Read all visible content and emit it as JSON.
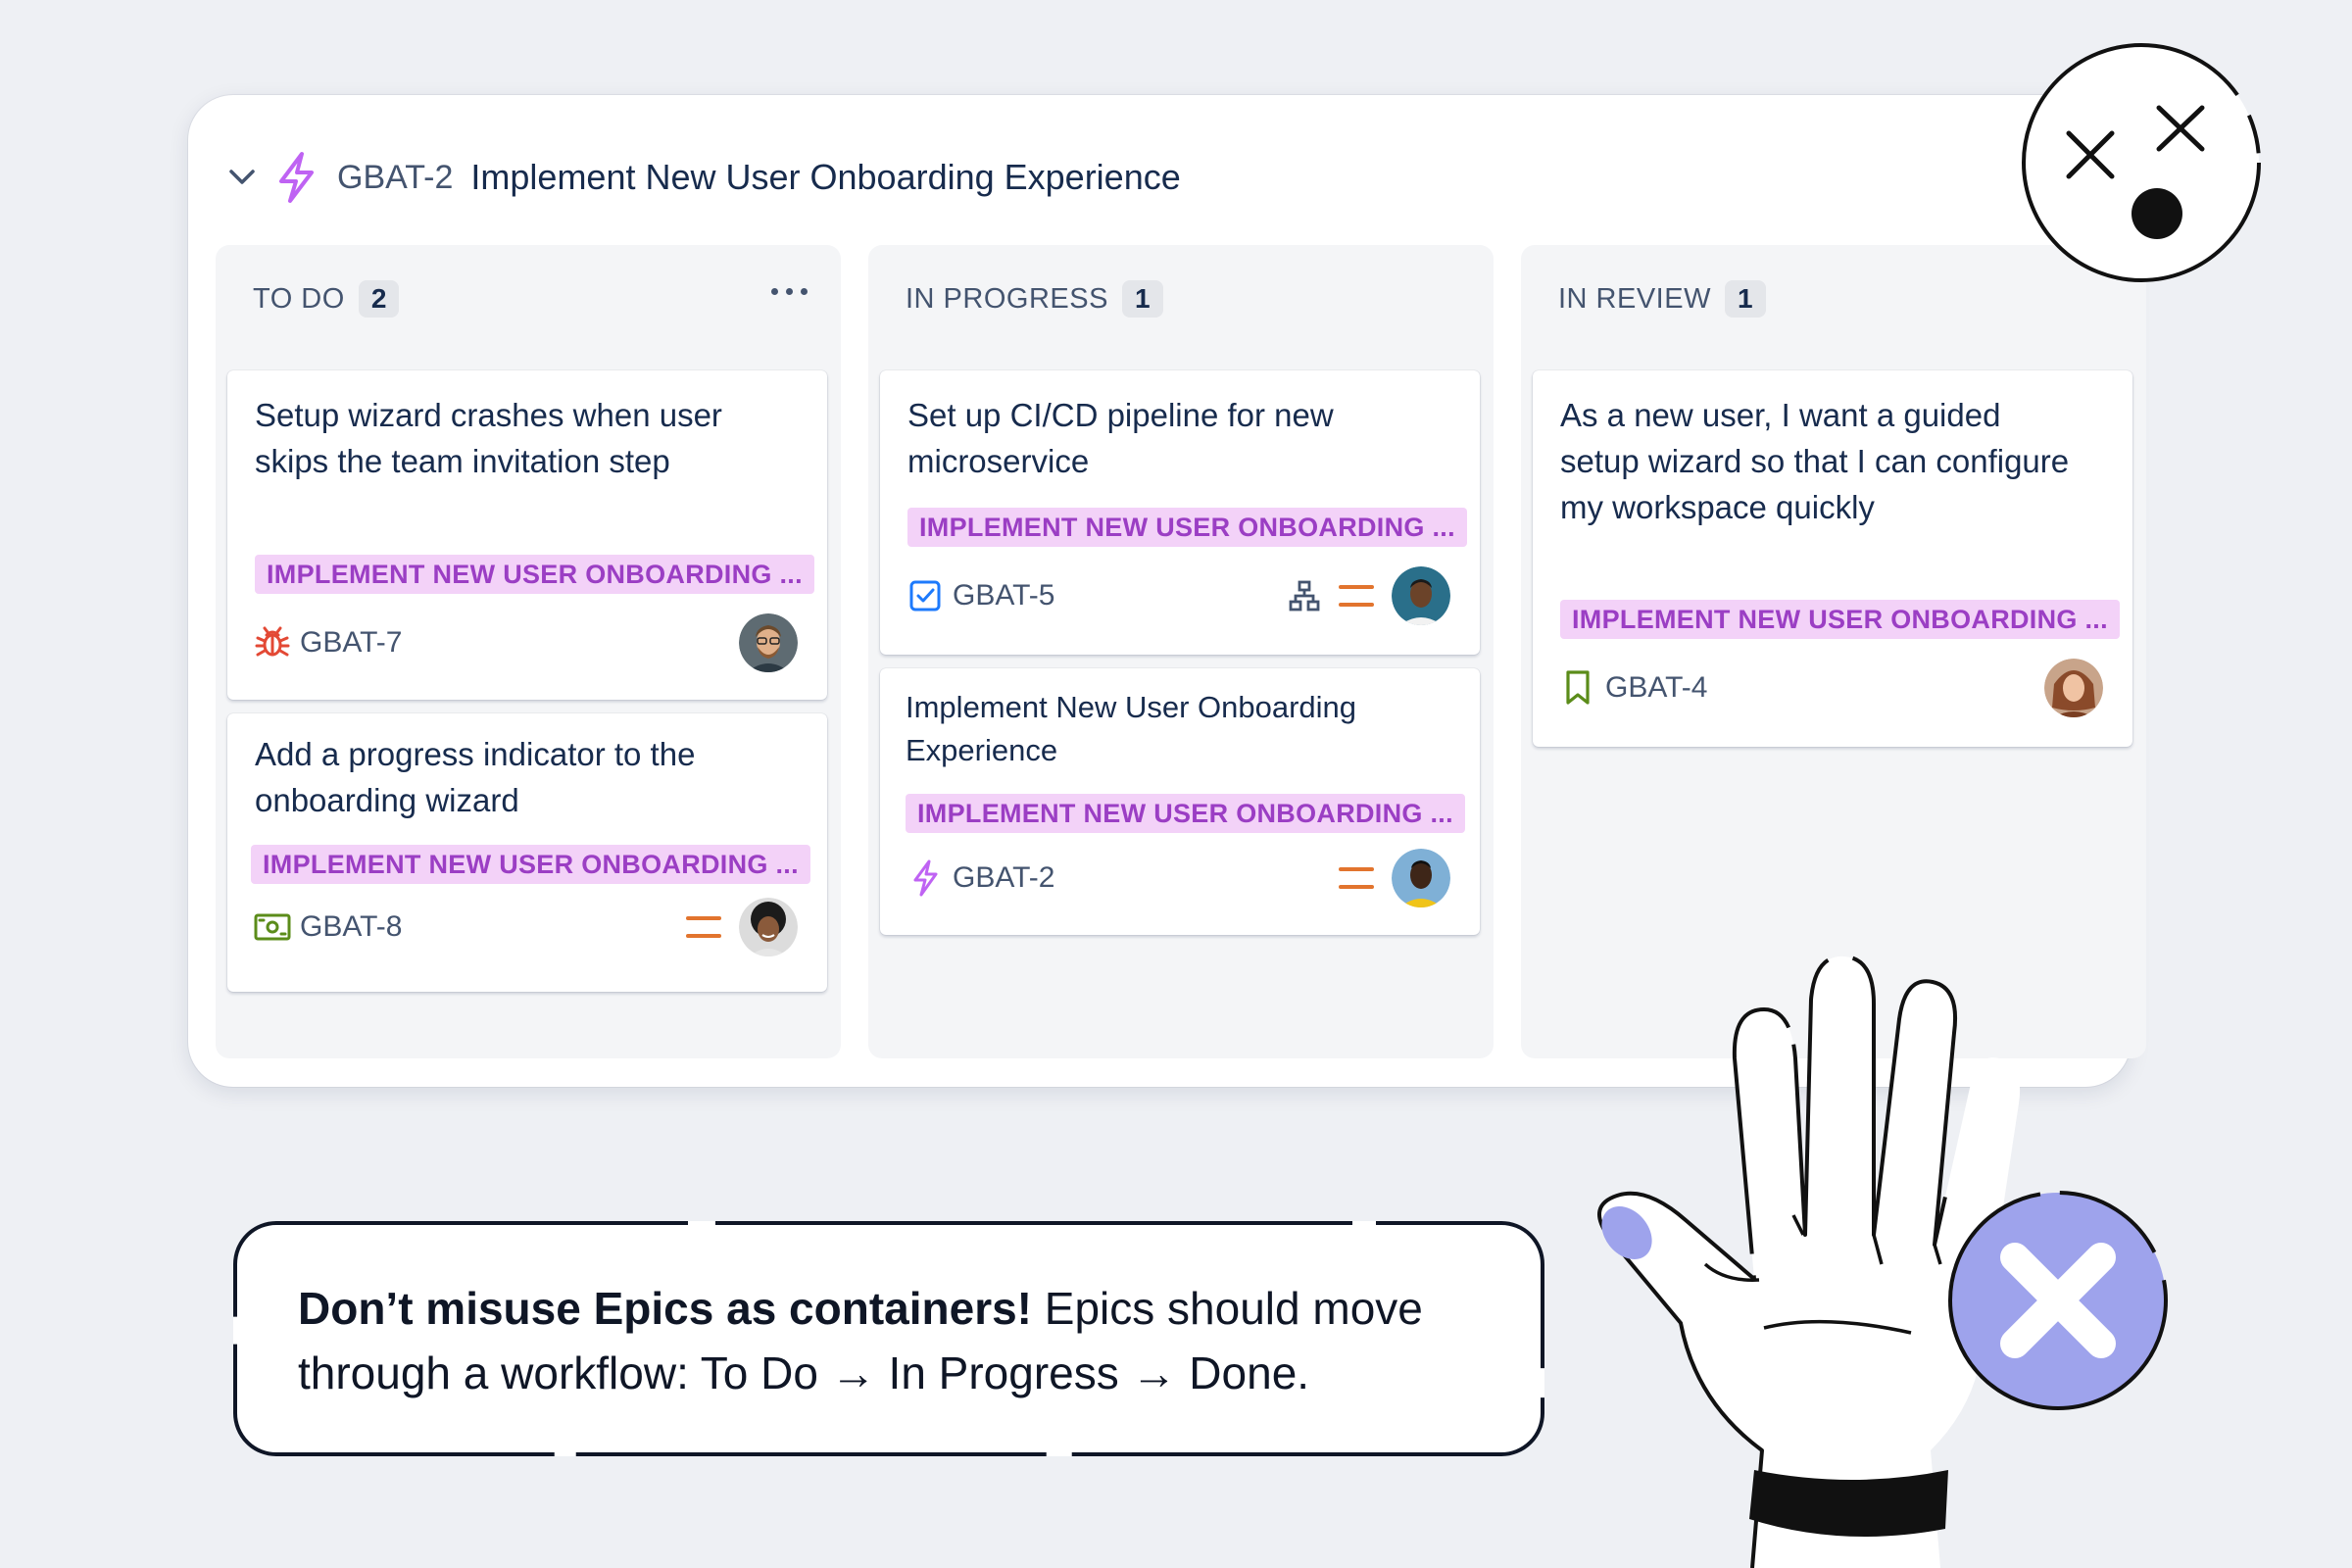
{
  "epic": {
    "key": "GBAT-2",
    "title": "Implement New User Onboarding Experience"
  },
  "columns": [
    {
      "name": "TO DO",
      "count": "2",
      "cards": [
        {
          "title": "Setup wizard crashes when user skips the team invitation step",
          "epic_label": "IMPLEMENT NEW USER ONBOARDING ...",
          "type_icon": "bug-icon",
          "key": "GBAT-7"
        },
        {
          "title": "Add a progress indicator to the onboarding wizard",
          "epic_label": "IMPLEMENT NEW USER ONBOARDING ...",
          "type_icon": "task-money-icon",
          "key": "GBAT-8"
        }
      ]
    },
    {
      "name": "IN PROGRESS",
      "count": "1",
      "cards": [
        {
          "title": "Set up CI/CD pipeline for new microservice",
          "epic_label": "IMPLEMENT NEW USER ONBOARDING ...",
          "type_icon": "task-checkbox-icon",
          "key": "GBAT-5"
        },
        {
          "title": "Implement New User Onboarding Experience",
          "epic_label": "IMPLEMENT NEW USER ONBOARDING ...",
          "type_icon": "epic-lightning-icon",
          "key": "GBAT-2"
        }
      ]
    },
    {
      "name": "IN REVIEW",
      "count": "1",
      "cards": [
        {
          "title": "As a new user, I want a guided setup wizard so that I can configure my workspace quickly",
          "epic_label": "IMPLEMENT NEW USER ONBOARDING ...",
          "type_icon": "story-bookmark-icon",
          "key": "GBAT-4"
        }
      ]
    }
  ],
  "tip": {
    "bold": "Don’t misuse Epics as containers!",
    "rest": " Epics should move through a workflow: To Do → In Progress → Done."
  },
  "colors": {
    "epic_purple": "#bf63f3",
    "lozenge_bg": "#f3d2f8",
    "lozenge_text": "#9b3ec4",
    "priority_orange": "#e2742e",
    "bug_red": "#e34935",
    "story_green": "#5b8c1a",
    "task_blue": "#1d7afc",
    "reject_circle": "#9ea3ec"
  }
}
